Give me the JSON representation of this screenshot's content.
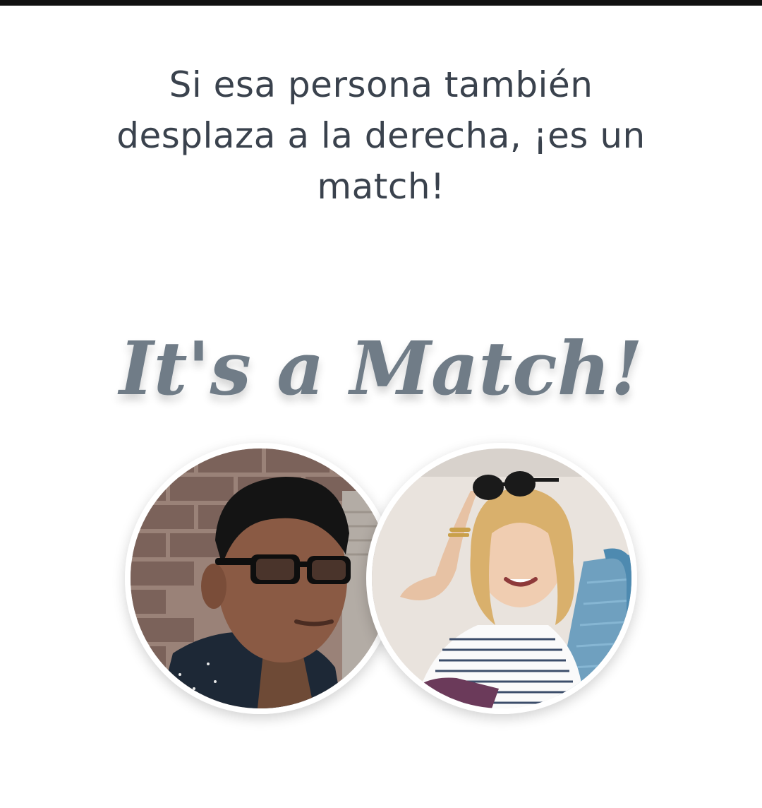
{
  "header": {
    "headline_line1": "Si esa persona también",
    "headline_line2": "desplaza a la derecha, ¡es un",
    "headline_line3": "match!"
  },
  "match_banner": {
    "text": "It's a Match!",
    "color": "#6f7c87"
  },
  "profiles": [
    {
      "icon": "person-photo-man-glasses"
    },
    {
      "icon": "person-photo-woman-sunglasses"
    }
  ]
}
